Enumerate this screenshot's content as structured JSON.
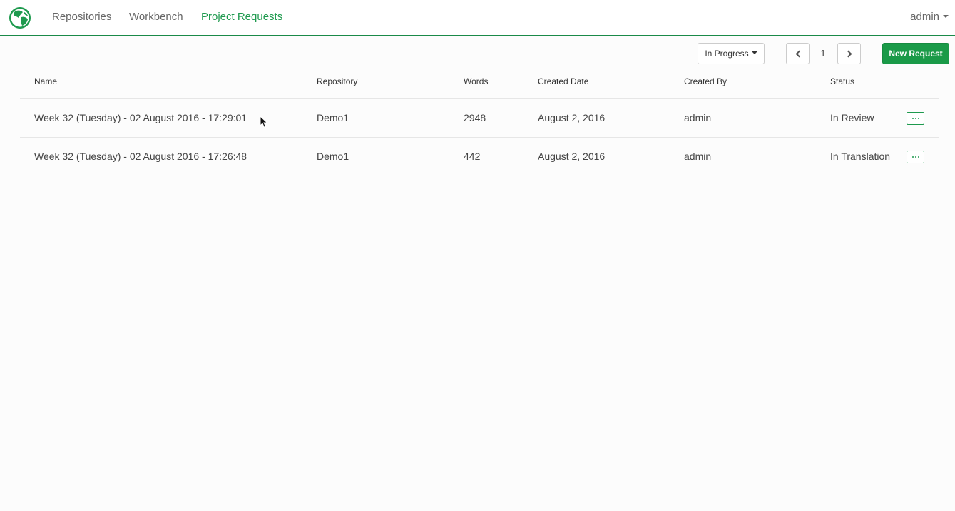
{
  "nav": {
    "items": [
      {
        "label": "Repositories"
      },
      {
        "label": "Workbench"
      },
      {
        "label": "Project Requests"
      }
    ],
    "user": "admin"
  },
  "toolbar": {
    "filter": "In Progress",
    "page": "1",
    "new_request": "New Request"
  },
  "table": {
    "headers": [
      "Name",
      "Repository",
      "Words",
      "Created Date",
      "Created By",
      "Status"
    ],
    "rows": [
      {
        "name": "Week 32 (Tuesday) - 02 August 2016 - 17:29:01",
        "repository": "Demo1",
        "words": "2948",
        "created_date": "August 2, 2016",
        "created_by": "admin",
        "status": "In Review"
      },
      {
        "name": "Week 32 (Tuesday) - 02 August 2016 - 17:26:48",
        "repository": "Demo1",
        "words": "442",
        "created_date": "August 2, 2016",
        "created_by": "admin",
        "status": "In Translation"
      }
    ]
  },
  "colors": {
    "accent": "#1e9a4e",
    "primary_button": "#1a9a48"
  }
}
